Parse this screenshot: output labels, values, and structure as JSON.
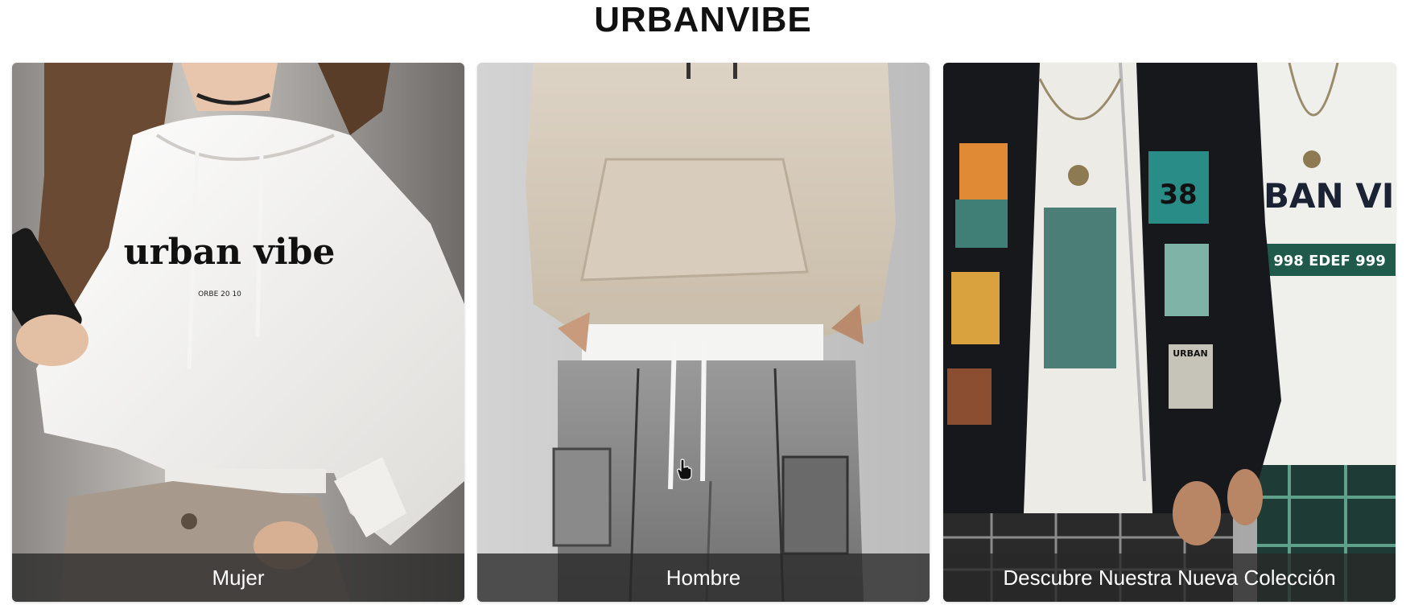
{
  "header": {
    "brand": "URBANVIBE"
  },
  "cards": [
    {
      "label": "Mujer",
      "print_main": "urban vibe",
      "print_sub": "ORBE 20 10"
    },
    {
      "label": "Hombre"
    },
    {
      "label": "Descubre Nuestra Nueva Colección",
      "shirt_print": "URBAN VIB",
      "shirt_band": "998 EDEF 999",
      "patch_number": "38",
      "patch_text": "URBAN"
    }
  ],
  "colors": {
    "caption_bg": "#282828",
    "caption_text": "#ffffff",
    "title": "#111111",
    "band_green": "#1f5a4a"
  }
}
